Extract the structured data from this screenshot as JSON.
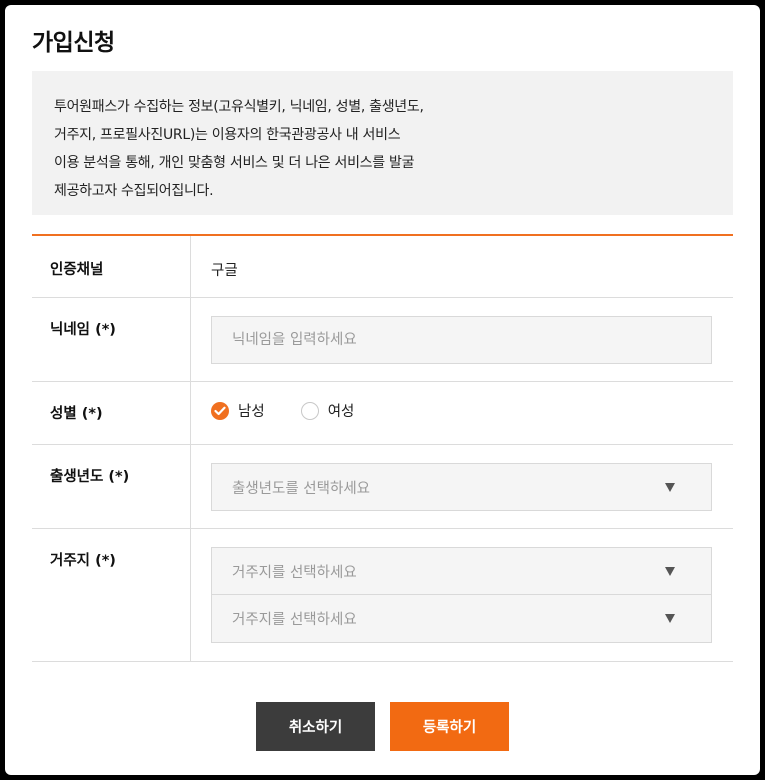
{
  "title": "가입신청",
  "notice": {
    "line1": "투어원패스가 수집하는 정보(고유식별키, 닉네임, 성별, 출생년도,",
    "line2": "거주지, 프로필사진URL)는 이용자의 한국관광공사 내 서비스",
    "line3": "이용 분석을 통해, 개인 맞춤형 서비스 및 더 나은 서비스를 발굴",
    "line4": "제공하고자 수집되어집니다."
  },
  "form": {
    "channel": {
      "label": "인증채널",
      "value": "구글"
    },
    "nickname": {
      "label": "닉네임 (*)",
      "value": "",
      "placeholder": "닉네임을 입력하세요"
    },
    "gender": {
      "label": "성별 (*)",
      "options": [
        {
          "label": "남성",
          "checked": true
        },
        {
          "label": "여성",
          "checked": false
        }
      ]
    },
    "birth_year": {
      "label": "출생년도 (*)",
      "placeholder": "출생년도를 선택하세요"
    },
    "residence": {
      "label": "거주지 (*)",
      "select1_placeholder": "거주지를 선택하세요",
      "select2_placeholder": "거주지를 선택하세요"
    }
  },
  "buttons": {
    "cancel": "취소하기",
    "submit": "등록하기"
  },
  "colors": {
    "accent": "#f26a12",
    "dark_button": "#3c3c3c",
    "notice_bg": "#f2f2f2"
  }
}
